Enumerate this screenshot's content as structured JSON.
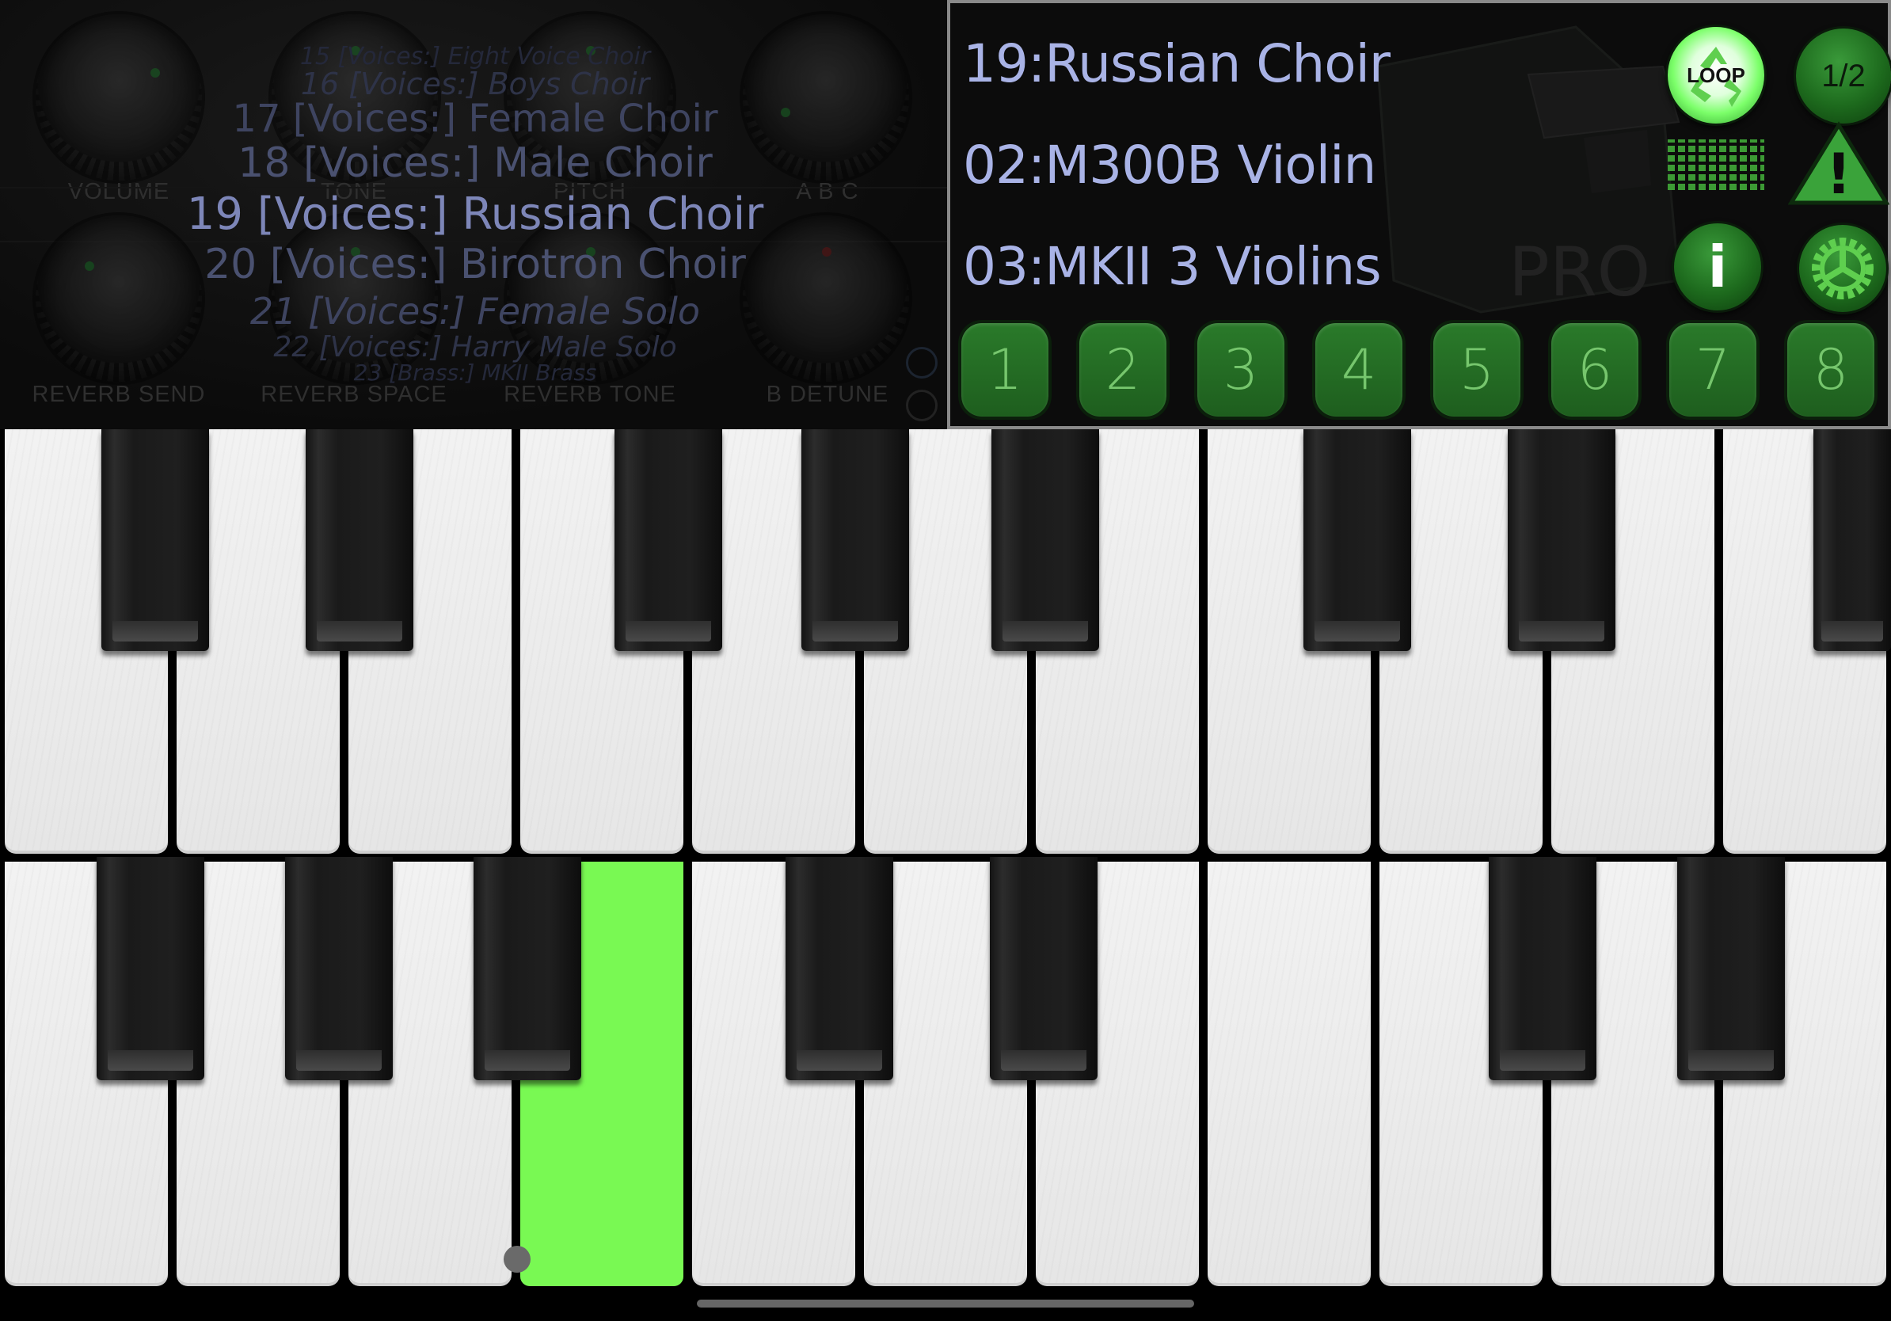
{
  "controls": {
    "row1": [
      "VOLUME",
      "TONE",
      "PITCH",
      "A   B   C"
    ],
    "row2": [
      "REVERB SEND",
      "REVERB SPACE",
      "REVERB TONE",
      "B DETUNE"
    ]
  },
  "preset_list": [
    "15 [Voices:] Eight Voice Choir",
    "16 [Voices:] Boys Choir",
    "17 [Voices:] Female Choir",
    "18 [Voices:] Male Choir",
    "19 [Voices:] Russian Choir",
    "20 [Voices:] Birotron Choir",
    "21 [Voices:] Female Solo",
    "22 [Voices:] Harry Male Solo",
    "23 [Brass:] MKII Brass"
  ],
  "pro_panel": {
    "slots": [
      "19:Russian Choir",
      "02:M300B Violin",
      "03:MKII 3 Violins"
    ],
    "loop_label": "LOOP",
    "half_label": "1/2",
    "info_label": "i",
    "warning_label": "!",
    "watermark": "PRO",
    "bank_buttons": [
      "1",
      "2",
      "3",
      "4",
      "5",
      "6",
      "7",
      "8"
    ]
  },
  "colors": {
    "accent_green": "#79f953",
    "slot_text": "#a9b3e6",
    "button_green": "#1e6a1e"
  },
  "keyboard": {
    "pressed_key": "lower-white-key-4"
  }
}
